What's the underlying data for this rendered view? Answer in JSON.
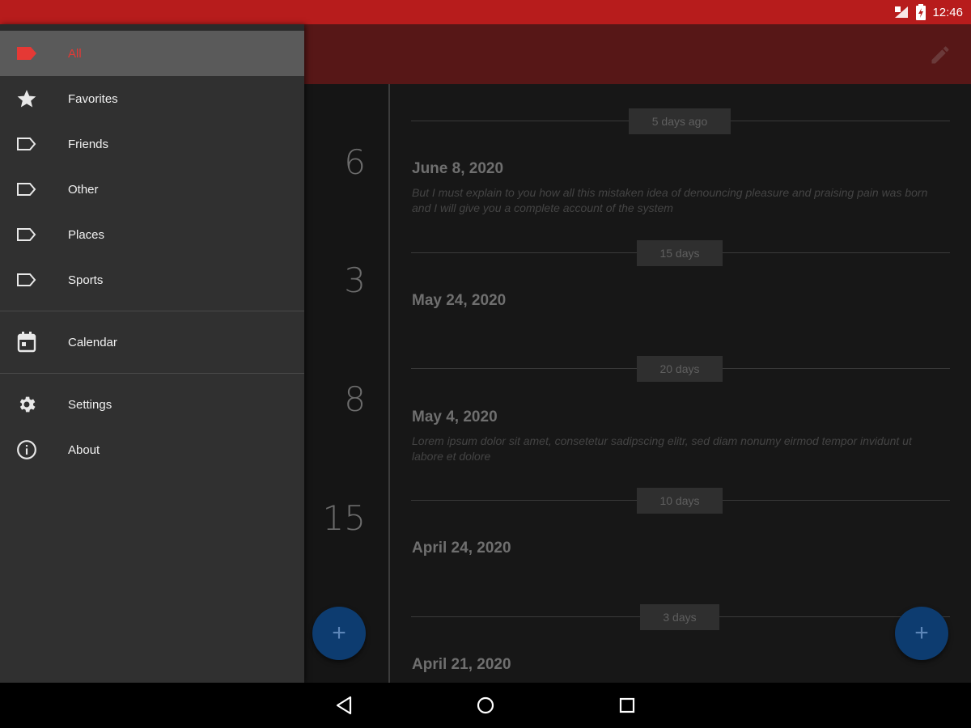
{
  "status": {
    "time": "12:46"
  },
  "drawer": {
    "groups": [
      [
        {
          "label": "All",
          "icon": "label-filled-icon",
          "active": true
        },
        {
          "label": "Favorites",
          "icon": "star-icon"
        },
        {
          "label": "Friends",
          "icon": "label-outline-icon"
        },
        {
          "label": "Other",
          "icon": "label-outline-icon"
        },
        {
          "label": "Places",
          "icon": "label-outline-icon"
        },
        {
          "label": "Sports",
          "icon": "label-outline-icon"
        }
      ],
      [
        {
          "label": "Calendar",
          "icon": "calendar-icon"
        }
      ],
      [
        {
          "label": "Settings",
          "icon": "gear-icon"
        },
        {
          "label": "About",
          "icon": "info-icon"
        }
      ]
    ]
  },
  "toolbar": {
    "edit_icon": "pencil-icon"
  },
  "timeline": {
    "day_numbers": [
      "6",
      "3",
      "8",
      "15"
    ],
    "gaps": [
      "5 days ago",
      "15 days",
      "20 days",
      "10 days",
      "3 days"
    ],
    "entries": [
      {
        "date": "June 8, 2020",
        "text_line1": "But I must explain to you how all this mistaken idea of denouncing pleasure and praising pain was born",
        "text_line2": "and I will give you a complete account of the system"
      },
      {
        "date": "May 24, 2020",
        "text_line1": "",
        "text_line2": ""
      },
      {
        "date": "May 4, 2020",
        "text_line1": "Lorem ipsum dolor sit amet, consetetur sadipscing elitr, sed diam nonumy eirmod tempor invidunt ut",
        "text_line2": "labore et dolore"
      },
      {
        "date": "April 24, 2020",
        "text_line1": "",
        "text_line2": ""
      },
      {
        "date": "April 21, 2020",
        "text_line1": "",
        "text_line2": ""
      }
    ]
  },
  "fab": {
    "label": "+"
  },
  "colors": {
    "status_bar": "#b71c1c",
    "toolbar": "#571717",
    "accent": "#e53935",
    "fab": "#0d3c70",
    "drawer": "#303030"
  }
}
